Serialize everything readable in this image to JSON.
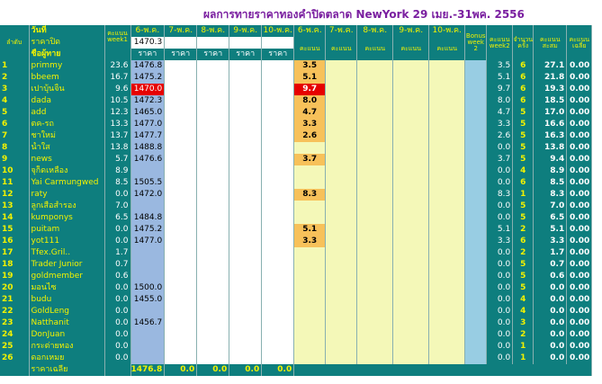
{
  "title": "ผลการทายราคาทองคำปิดตลาด NewYork 29 เมย.-31พค. 2556",
  "header": {
    "rank_label": "ลำดับ",
    "day_label": "วันที่",
    "close_label": "ราคาปิด",
    "name_label": "ชื่อผู้ทาย",
    "score_week1": "คะแนน week1",
    "dates": [
      "6-พ.ค.",
      "7-พ.ค.",
      "8-พ.ค.",
      "9-พ.ค.",
      "10-พ.ค."
    ],
    "price_label": "ราคา",
    "score_label": "คะแนน",
    "bonus_label": "Bonus week 2",
    "score_week2": "คะแนน week2",
    "count_label": "จำนวนครั้ง",
    "total_label": "คะแนนสะสม",
    "avg_label": "คะแนนเฉลี่ย",
    "close_value": "1470.3"
  },
  "rows": [
    {
      "rank": "1",
      "name": "primmy",
      "w1": "23.6",
      "p": "1476.8",
      "s": "3.5",
      "w2": "3.5",
      "n": "6",
      "tot": "27.1",
      "avg": "0.00"
    },
    {
      "rank": "2",
      "name": "bbeem",
      "w1": "16.7",
      "p": "1475.2",
      "s": "5.1",
      "w2": "5.1",
      "n": "6",
      "tot": "21.8",
      "avg": "0.00"
    },
    {
      "rank": "3",
      "name": "เปาบุ้นจิ้น",
      "w1": "9.6",
      "p": "1470.0",
      "s": "9.7",
      "w2": "9.7",
      "n": "6",
      "tot": "19.3",
      "avg": "0.00",
      "red": true
    },
    {
      "rank": "4",
      "name": "dada",
      "w1": "10.5",
      "p": "1472.3",
      "s": "8.0",
      "w2": "8.0",
      "n": "6",
      "tot": "18.5",
      "avg": "0.00"
    },
    {
      "rank": "5",
      "name": "add",
      "w1": "12.3",
      "p": "1465.0",
      "s": "4.7",
      "w2": "4.7",
      "n": "5",
      "tot": "17.0",
      "avg": "0.00"
    },
    {
      "rank": "6",
      "name": "ตค-รถ",
      "w1": "13.3",
      "p": "1477.0",
      "s": "3.3",
      "w2": "3.3",
      "n": "5",
      "tot": "16.6",
      "avg": "0.00"
    },
    {
      "rank": "7",
      "name": "ชาใหม่",
      "w1": "13.7",
      "p": "1477.7",
      "s": "2.6",
      "w2": "2.6",
      "n": "5",
      "tot": "16.3",
      "avg": "0.00"
    },
    {
      "rank": "8",
      "name": "น้ำใส",
      "w1": "13.8",
      "p": "1488.8",
      "s": "",
      "w2": "0.0",
      "n": "5",
      "tot": "13.8",
      "avg": "0.00"
    },
    {
      "rank": "9",
      "name": "news",
      "w1": "5.7",
      "p": "1476.6",
      "s": "3.7",
      "w2": "3.7",
      "n": "5",
      "tot": "9.4",
      "avg": "0.00"
    },
    {
      "rank": "10",
      "name": "จุก็ดเหลือง",
      "w1": "8.9",
      "p": "",
      "s": "",
      "w2": "0.0",
      "n": "4",
      "tot": "8.9",
      "avg": "0.00"
    },
    {
      "rank": "11",
      "name": "Yai Carmungwed",
      "w1": "8.5",
      "p": "1505.5",
      "s": "",
      "w2": "0.0",
      "n": "6",
      "tot": "8.5",
      "avg": "0.00"
    },
    {
      "rank": "12",
      "name": "raty",
      "w1": "0.0",
      "p": "1472.0",
      "s": "8.3",
      "w2": "8.3",
      "n": "1",
      "tot": "8.3",
      "avg": "0.00"
    },
    {
      "rank": "13",
      "name": "ลูกเสือสำรอง",
      "w1": "7.0",
      "p": "",
      "s": "",
      "w2": "0.0",
      "n": "5",
      "tot": "7.0",
      "avg": "0.00"
    },
    {
      "rank": "14",
      "name": "kumponys",
      "w1": "6.5",
      "p": "1484.8",
      "s": "",
      "w2": "0.0",
      "n": "5",
      "tot": "6.5",
      "avg": "0.00"
    },
    {
      "rank": "15",
      "name": "puitam",
      "w1": "0.0",
      "p": "1475.2",
      "s": "5.1",
      "w2": "5.1",
      "n": "2",
      "tot": "5.1",
      "avg": "0.00"
    },
    {
      "rank": "16",
      "name": "yot111",
      "w1": "0.0",
      "p": "1477.0",
      "s": "3.3",
      "w2": "3.3",
      "n": "6",
      "tot": "3.3",
      "avg": "0.00"
    },
    {
      "rank": "17",
      "name": "Tfex.Gril..",
      "w1": "1.7",
      "p": "",
      "s": "",
      "w2": "0.0",
      "n": "2",
      "tot": "1.7",
      "avg": "0.00"
    },
    {
      "rank": "18",
      "name": "Trader Junior",
      "w1": "0.7",
      "p": "",
      "s": "",
      "w2": "0.0",
      "n": "5",
      "tot": "0.7",
      "avg": "0.00"
    },
    {
      "rank": "19",
      "name": "goldmember",
      "w1": "0.6",
      "p": "",
      "s": "",
      "w2": "0.0",
      "n": "5",
      "tot": "0.6",
      "avg": "0.00"
    },
    {
      "rank": "20",
      "name": "มอนไซ",
      "w1": "0.0",
      "p": "1500.0",
      "s": "",
      "w2": "0.0",
      "n": "5",
      "tot": "0.0",
      "avg": "0.00"
    },
    {
      "rank": "21",
      "name": "budu",
      "w1": "0.0",
      "p": "1455.0",
      "s": "",
      "w2": "0.0",
      "n": "4",
      "tot": "0.0",
      "avg": "0.00"
    },
    {
      "rank": "22",
      "name": "GoldLeng",
      "w1": "0.0",
      "p": "",
      "s": "",
      "w2": "0.0",
      "n": "4",
      "tot": "0.0",
      "avg": "0.00"
    },
    {
      "rank": "23",
      "name": "Natthanit",
      "w1": "0.0",
      "p": "1456.7",
      "s": "",
      "w2": "0.0",
      "n": "3",
      "tot": "0.0",
      "avg": "0.00"
    },
    {
      "rank": "24",
      "name": "DonJuan",
      "w1": "0.0",
      "p": "",
      "s": "",
      "w2": "0.0",
      "n": "2",
      "tot": "0.0",
      "avg": "0.00"
    },
    {
      "rank": "25",
      "name": "กระต่ายทอง",
      "w1": "0.0",
      "p": "",
      "s": "",
      "w2": "0.0",
      "n": "1",
      "tot": "0.0",
      "avg": "0.00"
    },
    {
      "rank": "26",
      "name": "ดอกเหมย",
      "w1": "0.0",
      "p": "",
      "s": "",
      "w2": "0.0",
      "n": "1",
      "tot": "0.0",
      "avg": "0.00"
    }
  ],
  "footer": {
    "label": "ราคาเฉลี่ย",
    "avgs": [
      "1476.8",
      "0.0",
      "0.0",
      "0.0",
      "0.0"
    ]
  },
  "colors": {
    "teal": "#0e7e7e",
    "yellow_text": "#f2f200",
    "price_blue": "#9ab8e0",
    "score_lime": "#f4f8b8",
    "score_orange": "#f7c15a",
    "highlight_red": "#e60000",
    "bonus_blue": "#98cde3"
  }
}
